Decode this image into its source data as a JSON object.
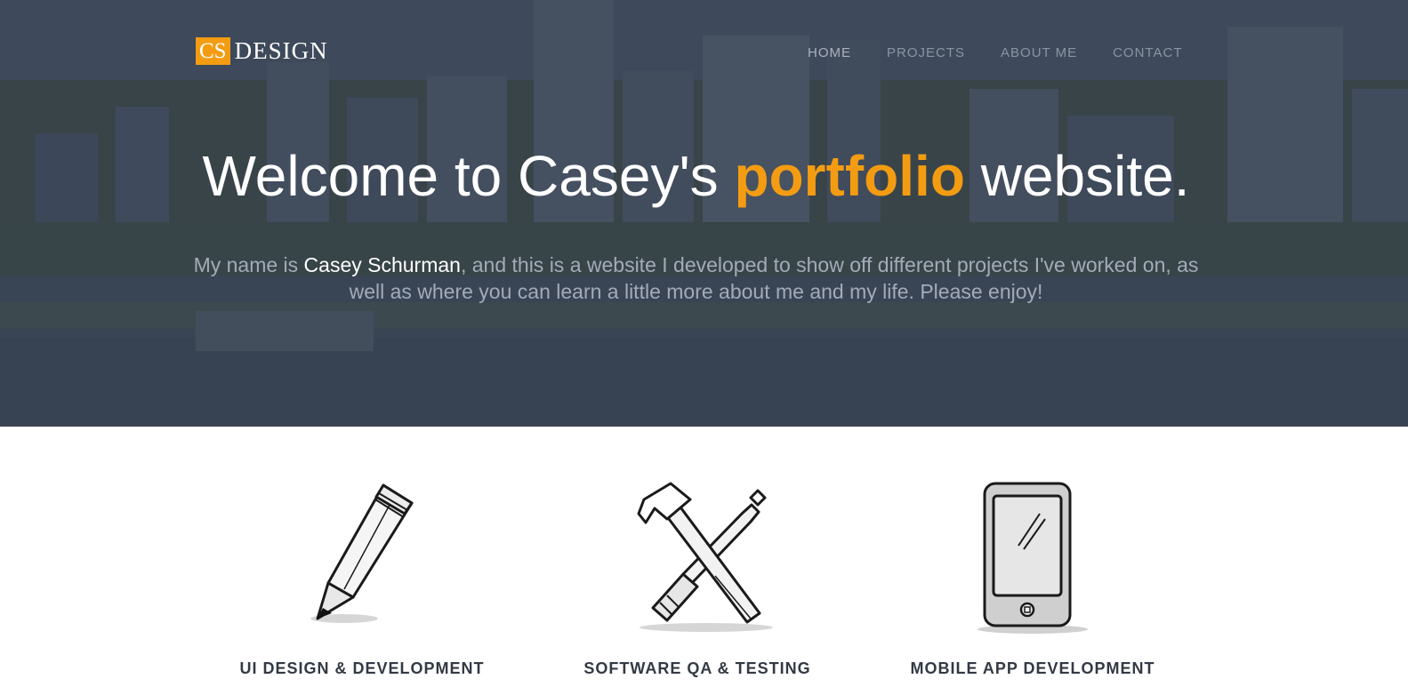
{
  "header": {
    "logo": {
      "cs": "CS",
      "design": "DESIGN"
    },
    "nav": [
      {
        "label": "HOME"
      },
      {
        "label": "PROJECTS"
      },
      {
        "label": "ABOUT ME"
      },
      {
        "label": "CONTACT"
      }
    ]
  },
  "hero": {
    "title_before": "Welcome to Casey's ",
    "title_accent": "portfolio",
    "title_after": " website.",
    "intro_before": "My name is ",
    "intro_name": "Casey Schurman",
    "intro_after": ", and this is a website I developed to show off different projects I've worked on, as well as where you can learn a little more about me and my life. Please enjoy!"
  },
  "services": [
    {
      "title": "UI DESIGN & DEVELOPMENT",
      "icon": "pencil-icon"
    },
    {
      "title": "SOFTWARE QA & TESTING",
      "icon": "tools-icon"
    },
    {
      "title": "MOBILE APP DEVELOPMENT",
      "icon": "smartphone-icon"
    }
  ],
  "colors": {
    "accent": "#f39c12",
    "hero_overlay": "#344052",
    "heading_dark": "#333a44"
  }
}
